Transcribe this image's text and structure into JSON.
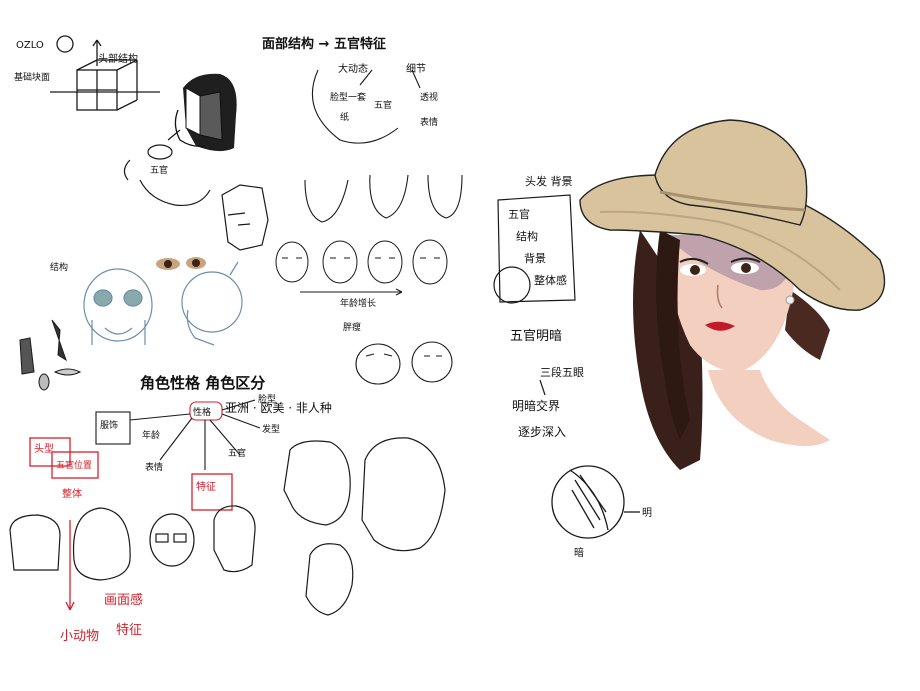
{
  "notes": {
    "top_left_labels": [
      "OZLO",
      "头部结构",
      "基础块面"
    ],
    "title_flow": "面部结构 → 五官特征",
    "flow_sub": [
      "大动态",
      "细节"
    ],
    "flow_items": [
      "脸型一套",
      "纸",
      "五官",
      "透视",
      "表情"
    ],
    "age_arrow_label": "年龄增长",
    "fat_label": "胖瘦",
    "center_title": "角色性格 角色区分",
    "center_sub": "亚洲 · 欧美 · 非人种",
    "mindmap_center": "性格",
    "mindmap_items": [
      "脸型",
      "发型",
      "五官",
      "服饰",
      "年龄",
      "表情"
    ],
    "red_notes": [
      "头型",
      "五官位置",
      "整体",
      "特征",
      "画面感",
      "小动物",
      "特征"
    ],
    "right_notes": [
      "头发 背景",
      "五官",
      "结构",
      "背景",
      "整体感",
      "五官明暗",
      "三段五眼",
      "明暗交界",
      "逐步深入",
      "明",
      "暗"
    ]
  },
  "colors": {
    "ink": "#1a1a1a",
    "red": "#d4202a",
    "hat": "#d9c39c",
    "hat_shadow": "#a89171",
    "hair": "#3a201a",
    "skin": "#f2cfbf",
    "skin_shadow": "#b69aa8"
  }
}
